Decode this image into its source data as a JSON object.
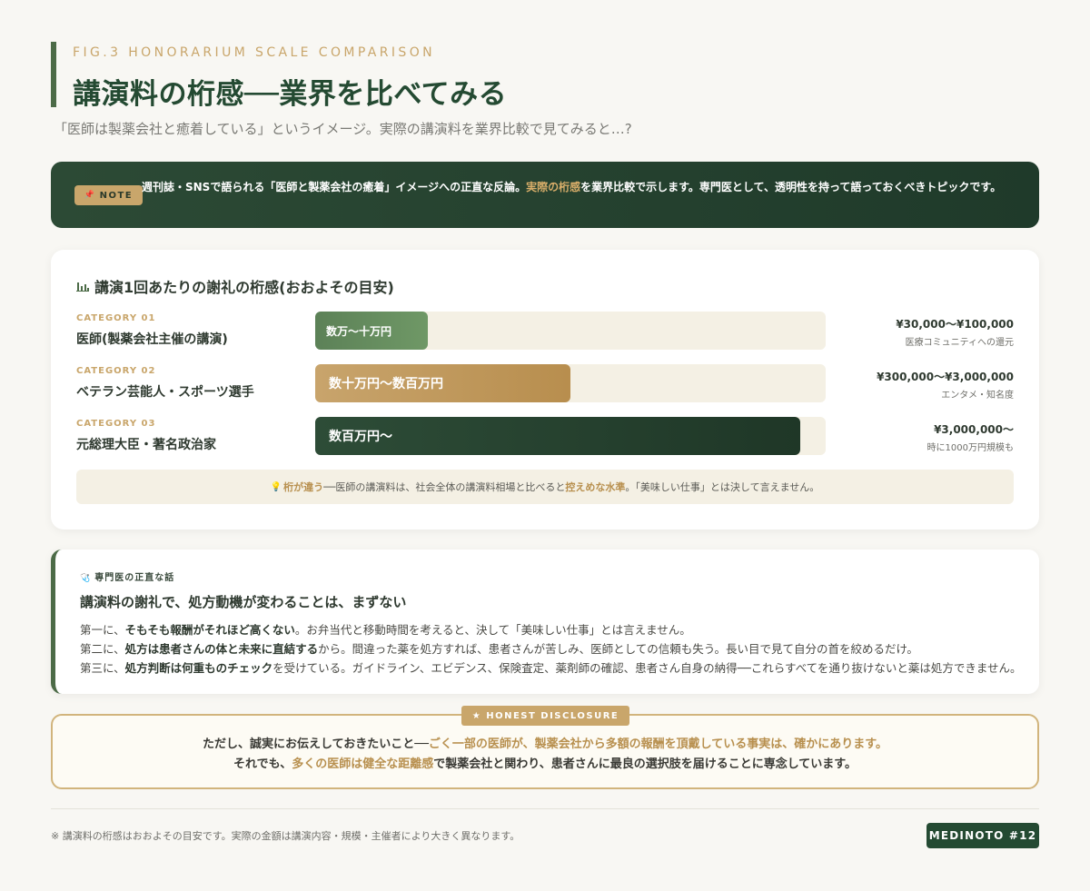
{
  "header": {
    "fig_label": "FIG.3 HONORARIUM SCALE COMPARISON",
    "title": "講演料の桁感──業界を比べてみる",
    "subtitle": "「医師は製薬会社と癒着している」というイメージ。実際の講演料を業界比較で見てみると…?"
  },
  "note": {
    "badge_icon": "pin-icon",
    "badge_glyph": "📌",
    "badge_label": "NOTE",
    "text_before": "週刊誌・SNSで語られる「医師と製薬会社の癒着」イメージへの正直な反論。",
    "text_highlight": "実際の桁感",
    "text_after": "を業界比較で示します。専門医として、透明性を持って語っておくべきトピックです。"
  },
  "comparison": {
    "title_icon": "bar-chart-icon",
    "title": "講演1回あたりの謝礼の桁感(おおよその目安)",
    "rows": [
      {
        "category_label": "CATEGORY 01",
        "name": "医師(製薬会社主催の講演)",
        "bar_label": "数万〜十万円",
        "fill_pct": 22,
        "amount": "¥30,000〜¥100,000",
        "amount_note": "医療コミュニティへの還元"
      },
      {
        "category_label": "CATEGORY 02",
        "name": "ベテラン芸能人・スポーツ選手",
        "bar_label": "数十万円〜数百万円",
        "fill_pct": 50,
        "amount": "¥300,000〜¥3,000,000",
        "amount_note": "エンタメ・知名度"
      },
      {
        "category_label": "CATEGORY 03",
        "name": "元総理大臣・著名政治家",
        "bar_label": "数百万円〜",
        "fill_pct": 95,
        "amount": "¥3,000,000〜",
        "amount_note": "時に1000万円規模も"
      }
    ],
    "tip": {
      "icon": "lightbulb-icon",
      "glyph": "💡",
      "lead": "桁が違う",
      "middle": "──医師の講演料は、社会全体の講演料相場と比べると",
      "highlight": "控えめな水準",
      "tail": "。「美味しい仕事」とは決して言えません。"
    }
  },
  "expert": {
    "kicker_icon": "stethoscope-icon",
    "kicker_glyph": "🩺",
    "kicker": "専門医の正直な話",
    "title": "講演料の謝礼で、処方動機が変わることは、まずない",
    "lines": [
      {
        "pre": "第一に、",
        "strong": "そもそも報酬がそれほど高くない",
        "post": "。お弁当代と移動時間を考えると、決して「美味しい仕事」とは言えません。"
      },
      {
        "pre": "第二に、",
        "strong": "処方は患者さんの体と未来に直結する",
        "post": "から。間違った薬を処方すれば、患者さんが苦しみ、医師としての信頼も失う。長い目で見て自分の首を絞めるだけ。"
      },
      {
        "pre": "第三に、",
        "strong": "処方判断は何重ものチェック",
        "post": "を受けている。ガイドライン、エビデンス、保険査定、薬剤師の確認、患者さん自身の納得──これらすべてを通り抜けないと薬は処方できません。"
      }
    ]
  },
  "disclosure": {
    "badge_icon": "star-icon",
    "badge": "★ HONEST DISCLOSURE",
    "line1_pre": "ただし、誠実にお伝えしておきたいこと──",
    "line1_highlight": "ごく一部の医師が、製薬会社から多額の報酬を頂戴している事実は、確かにあります。",
    "line2_pre": "それでも、",
    "line2_highlight": "多くの医師は健全な距離感",
    "line2_post": "で製薬会社と関わり、患者さんに最良の選択肢を届けることに専念しています。"
  },
  "footer": {
    "footnote": "※ 講演料の桁感はおおよその目安です。実際の金額は講演内容・規模・主催者により大きく異なります。",
    "badge": "MEDINOTO #12"
  },
  "colors": {
    "background": "#f8f7f3",
    "primary_green": "#244a32",
    "accent_gold": "#c9a66b",
    "note_bg": "#2c4a35"
  }
}
